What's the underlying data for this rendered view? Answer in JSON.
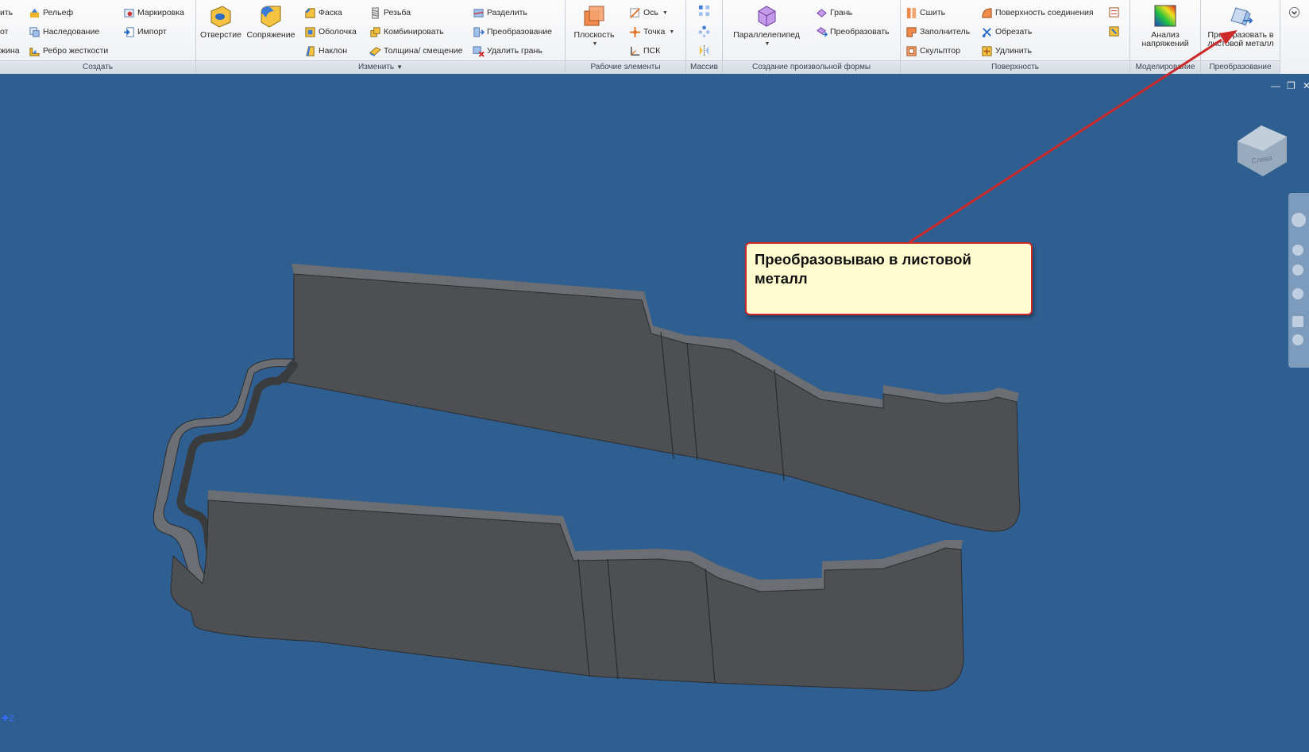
{
  "ribbon": {
    "panels": {
      "create": {
        "title": "Создать",
        "items": {
          "cut_top": "ить",
          "cut_mid": "от",
          "cut_bot": "жина",
          "emboss": "Рельеф",
          "derive": "Наследование",
          "rib": "Ребро жесткости",
          "decal": "Маркировка",
          "import": "Импорт"
        }
      },
      "modify": {
        "title": "Изменить",
        "items": {
          "hole": "Отверстие",
          "fillet": "Сопряжение",
          "chamfer": "Фаска",
          "shell": "Оболочка",
          "draft": "Наклон",
          "thread": "Резьба",
          "combine": "Комбинировать",
          "thicken": "Толщина/ смещение",
          "split": "Разделить",
          "transform": "Преобразование",
          "delete_face": "Удалить грань"
        }
      },
      "work_features": {
        "title": "Рабочие элементы",
        "items": {
          "plane": "Плоскость",
          "axis": "Ось",
          "point": "Точка",
          "ucs": "ПСК"
        }
      },
      "pattern": {
        "title": "Массив"
      },
      "freeform": {
        "title": "Создание произвольной формы",
        "items": {
          "box": "Параллелепипед",
          "face": "Грань",
          "convert": "Преобразовать"
        }
      },
      "surface": {
        "title": "Поверхность",
        "items": {
          "stitch": "Сшить",
          "patch": "Заполнитель",
          "sculpt": "Скульптор",
          "boundary_patch": "Поверхность соединения",
          "trim": "Обрезать",
          "extend": "Удлинить"
        }
      },
      "simulation": {
        "title": "Моделирование",
        "items": {
          "stress": "Анализ напряжений"
        }
      },
      "convert": {
        "title": "Преобразование",
        "items": {
          "sheet_metal": "Преобразовать в листовой металл"
        }
      }
    }
  },
  "viewport": {
    "background": "#2f5f90",
    "callout_text": "Преобразовываю в листовой металл",
    "viewcube_label": "Слева",
    "axis_label": "Z"
  },
  "colors": {
    "annotation": "#cc2a2a",
    "callout_bg": "#fffdd0",
    "part": "#4d4f52"
  }
}
